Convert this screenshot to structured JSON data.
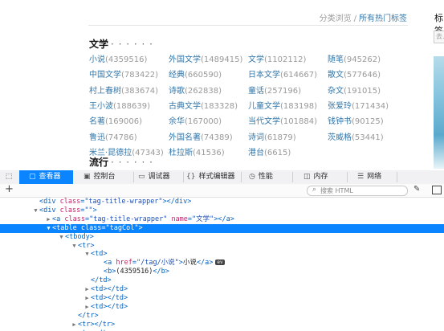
{
  "breadcrumb": {
    "item1": "分类浏览",
    "sep": "/",
    "item2": "所有热门标签"
  },
  "sections": [
    {
      "title": "文学",
      "dots": "· · · · · ·"
    },
    {
      "title": "流行",
      "dots": "· · · · · ·"
    }
  ],
  "tags": [
    [
      {
        "name": "小说",
        "count": "(4359516)"
      },
      {
        "name": "外国文学",
        "count": "(1489415)"
      },
      {
        "name": "文学",
        "count": "(1102112)"
      },
      {
        "name": "随笔",
        "count": "(945262)"
      }
    ],
    [
      {
        "name": "中国文学",
        "count": "(783422)"
      },
      {
        "name": "经典",
        "count": "(660590)"
      },
      {
        "name": "日本文学",
        "count": "(614667)"
      },
      {
        "name": "散文",
        "count": "(577646)"
      }
    ],
    [
      {
        "name": "村上春树",
        "count": "(383674)"
      },
      {
        "name": "诗歌",
        "count": "(262838)"
      },
      {
        "name": "童话",
        "count": "(257196)"
      },
      {
        "name": "杂文",
        "count": "(191015)"
      }
    ],
    [
      {
        "name": "王小波",
        "count": "(188639)"
      },
      {
        "name": "古典文学",
        "count": "(183328)"
      },
      {
        "name": "儿童文学",
        "count": "(183198)"
      },
      {
        "name": "张爱玲",
        "count": "(171434)"
      }
    ],
    [
      {
        "name": "名著",
        "count": "(169006)"
      },
      {
        "name": "余华",
        "count": "(167000)"
      },
      {
        "name": "当代文学",
        "count": "(101884)"
      },
      {
        "name": "钱钟书",
        "count": "(90125)"
      }
    ],
    [
      {
        "name": "鲁迅",
        "count": "(74786)"
      },
      {
        "name": "外国名著",
        "count": "(74389)"
      },
      {
        "name": "诗词",
        "count": "(61879)"
      },
      {
        "name": "茨威格",
        "count": "(53441)"
      }
    ],
    [
      {
        "name": "米兰·昆德拉",
        "count": "(47343)"
      },
      {
        "name": "杜拉斯",
        "count": "(41536)"
      },
      {
        "name": "港台",
        "count": "(6615)"
      }
    ]
  ],
  "sidebar": {
    "label": "标签",
    "input_text": "去..."
  },
  "devtools": {
    "tabs": [
      {
        "label": "查看器",
        "icon": "▢"
      },
      {
        "label": "控制台",
        "icon": "▣"
      },
      {
        "label": "调试器",
        "icon": "▭"
      },
      {
        "label": "样式编辑器",
        "icon": "{}"
      },
      {
        "label": "性能",
        "icon": "◷"
      },
      {
        "label": "内存",
        "icon": "◫"
      },
      {
        "label": "网络",
        "icon": "☰"
      }
    ],
    "search_placeholder": "搜索 HTML",
    "markup_lines": [
      {
        "indent": 5,
        "twisty": "",
        "parts": [
          [
            "tag",
            "<div "
          ],
          [
            "attr",
            "class"
          ],
          [
            "tag",
            "="
          ],
          [
            "val",
            "\"tag-title-wrapper\""
          ],
          [
            "tag",
            "></div>"
          ]
        ]
      },
      {
        "indent": 5,
        "twisty": "▼",
        "parts": [
          [
            "tag",
            "<div "
          ],
          [
            "attr",
            "class"
          ],
          [
            "tag",
            "="
          ],
          [
            "val",
            "\"\""
          ],
          [
            "tag",
            ">"
          ]
        ]
      },
      {
        "indent": 7,
        "twisty": "▶",
        "parts": [
          [
            "tag",
            "<a "
          ],
          [
            "attr",
            "class"
          ],
          [
            "tag",
            "="
          ],
          [
            "val",
            "\"tag-title-wrapper\""
          ],
          [
            "tag",
            " "
          ],
          [
            "attr",
            "name"
          ],
          [
            "tag",
            "="
          ],
          [
            "val",
            "\"文学\""
          ],
          [
            "tag",
            "></a>"
          ]
        ]
      },
      {
        "indent": 7,
        "twisty": "▼",
        "parts": [
          [
            "tag",
            "<table "
          ],
          [
            "attr",
            "class"
          ],
          [
            "tag",
            "="
          ],
          [
            "val",
            "\"tagCol\""
          ],
          [
            "tag",
            ">"
          ]
        ]
      },
      {
        "indent": 9,
        "twisty": "▼",
        "parts": [
          [
            "tag",
            "<tbody>"
          ]
        ]
      },
      {
        "indent": 11,
        "twisty": "▼",
        "parts": [
          [
            "tag",
            "<tr>"
          ]
        ]
      },
      {
        "indent": 13,
        "twisty": "▼",
        "parts": [
          [
            "tag",
            "<td>"
          ]
        ]
      },
      {
        "indent": 15,
        "twisty": "",
        "parts": [
          [
            "tag",
            "<a "
          ],
          [
            "attr",
            "href"
          ],
          [
            "tag",
            "="
          ],
          [
            "val",
            "\"/tag/小说\""
          ],
          [
            "tag",
            ">"
          ],
          [
            "txt",
            "小说"
          ],
          [
            "tag",
            "</a>"
          ]
        ],
        "badge": "ev"
      },
      {
        "indent": 15,
        "twisty": "",
        "parts": [
          [
            "tag",
            "<b>"
          ],
          [
            "txt",
            "(4359516)"
          ],
          [
            "tag",
            "</b>"
          ]
        ]
      },
      {
        "indent": 13,
        "twisty": "",
        "parts": [
          [
            "tag",
            "</td>"
          ]
        ]
      },
      {
        "indent": 13,
        "twisty": "▶",
        "parts": [
          [
            "tag",
            "<td></td>"
          ]
        ]
      },
      {
        "indent": 13,
        "twisty": "▶",
        "parts": [
          [
            "tag",
            "<td></td>"
          ]
        ]
      },
      {
        "indent": 13,
        "twisty": "▶",
        "parts": [
          [
            "tag",
            "<td></td>"
          ]
        ]
      },
      {
        "indent": 11,
        "twisty": "",
        "parts": [
          [
            "tag",
            "</tr>"
          ]
        ]
      },
      {
        "indent": 11,
        "twisty": "▶",
        "parts": [
          [
            "tag",
            "<tr></tr>"
          ]
        ]
      },
      {
        "indent": 11,
        "twisty": "▶",
        "parts": [
          [
            "tag",
            "<tr></tr>"
          ]
        ]
      }
    ],
    "selected_line": 3
  },
  "colors": {
    "accent": "#0a84ff",
    "link": "#3377aa"
  }
}
